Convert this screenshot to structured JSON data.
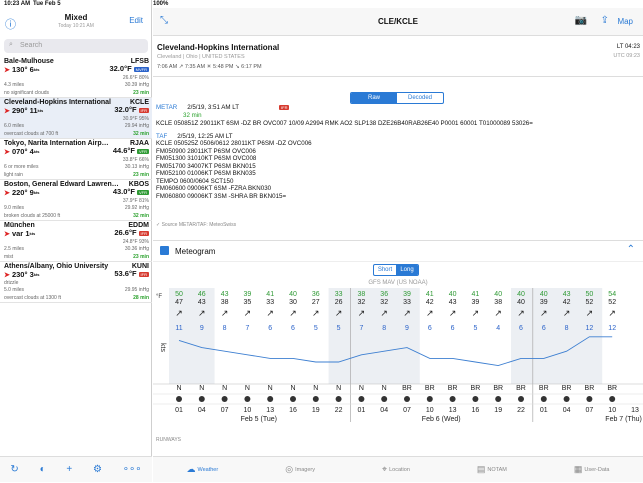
{
  "status": {
    "time": "10:23 AM",
    "date": "Tue Feb 5",
    "battery": "100%"
  },
  "left": {
    "title": "Mixed",
    "subtitle": "Today 10:21 AM",
    "edit": "Edit",
    "search_placeholder": "Search",
    "stations": [
      {
        "name": "Bale-Mulhouse",
        "code": "LFSB",
        "wind": "130° 6",
        "temp": "32.0°F",
        "flight": "MVFR",
        "ts": "26.6°F 80%",
        "vis": "4.3 miles",
        "press": "30.39 inHg",
        "wx": "no significant clouds",
        "age": "23 min"
      },
      {
        "name": "Cleveland-Hopkins International",
        "code": "KCLE",
        "wind": "290° 11",
        "temp": "32.0°F",
        "flight": "IFR",
        "ts": "30.9°F 95%",
        "vis": "6.0 miles",
        "press": "29.94 inHg",
        "wx": "overcast clouds at 700 ft",
        "age": "32 min"
      },
      {
        "name": "Tokyo, Narita Internation Airp…",
        "code": "RJAA",
        "wind": "070° 4",
        "temp": "44.6°F",
        "flight": "VFR",
        "ts": "33.8°F 66%",
        "vis": "6 or more miles",
        "press": "30.13 inHg",
        "wx": "light rain",
        "age": "23 min"
      },
      {
        "name": "Boston, General Edward Lawren…",
        "code": "KBOS",
        "wind": "220° 9",
        "temp": "43.0°F",
        "flight": "VFR",
        "ts": "37.9°F 81%",
        "vis": "9.0 miles",
        "press": "29.92 inHg",
        "wx": "broken clouds at 25000 ft",
        "age": "32 min"
      },
      {
        "name": "München",
        "code": "EDDM",
        "wind": "var 1",
        "temp": "26.6°F",
        "flight": "IFR",
        "ts": "24.8°F 93%",
        "vis": "2.5 miles",
        "press": "30.36 inHg",
        "wx": "mist",
        "age": "23 min"
      },
      {
        "name": "Athens/Albany, Ohio University",
        "code": "KUNI",
        "wind": "230° 3",
        "temp": "53.6°F",
        "flight": "IFR",
        "ts": "",
        "vis": "5.0 miles",
        "press": "29.95 inHg",
        "wx": "drizzle",
        "extra": "overcast clouds at 1300 ft",
        "age": "28 min"
      }
    ]
  },
  "right": {
    "title": "CLE/KCLE",
    "map": "Map",
    "airport": {
      "name": "Cleveland-Hopkins International",
      "location": "Cleveland | Ohio | UNITED STATES",
      "lt": "LT 04:23",
      "utc": "UTC 09:23",
      "sun": "7:06 AM ↗ 7:35 AM ☀ 5:48 PM ↘ 6:17 PM"
    },
    "toggle": {
      "raw": "Raw",
      "decoded": "Decoded"
    },
    "metar": {
      "label": "METAR",
      "time": "2/5/19, 3:51 AM LT",
      "flight": "IFR",
      "age": "32 min",
      "text": "KCLE 050851Z 29011KT 6SM -DZ BR OVC007 10/09 A2994 RMK AO2 SLP138 DZE26B40RAB26E40 P0001 60001 T01000089 53026="
    },
    "taf": {
      "label": "TAF",
      "time": "2/5/19, 12:25 AM LT",
      "lines": [
        "KCLE 050525Z 0506/0612 28011KT P6SM -DZ OVC006",
        "FM050900 28011KT P6SM OVC006",
        "FM051300 31010KT P6SM OVC008",
        "FM051700 34007KT P6SM BKN015",
        "FM052100 01006KT P6SM BKN035",
        "TEMPO 0600/0604 SCT150",
        "FM060600 09006KT 6SM -FZRA BKN030",
        "FM060800 09006KT 3SM -SHRA BR BKN015="
      ]
    },
    "source": "Source METAR/TAF: MeteoSwiss",
    "meteogram": {
      "title": "Meteogram",
      "short": "Short",
      "long": "Long",
      "model": "GFS MAV (US NOAA)"
    },
    "runways": "RUNWAYS",
    "tabs": [
      {
        "label": "Weather"
      },
      {
        "label": "Imagery"
      },
      {
        "label": "Location"
      },
      {
        "label": "NOTAM"
      },
      {
        "label": "User-Data"
      }
    ]
  },
  "chart_data": {
    "type": "table",
    "temp_hi": [
      50,
      46,
      43,
      39,
      41,
      40,
      36,
      33,
      38,
      36,
      39,
      41,
      40,
      41,
      40,
      40,
      40,
      43,
      50,
      54
    ],
    "temp_lo": [
      47,
      43,
      38,
      35,
      33,
      30,
      27,
      26,
      32,
      32,
      33,
      42,
      43,
      39,
      38,
      40,
      39,
      42,
      52,
      52
    ],
    "wind_kts": [
      11,
      9,
      8,
      7,
      6,
      6,
      5,
      5,
      7,
      8,
      9,
      6,
      6,
      5,
      4,
      6,
      6,
      8,
      12,
      12
    ],
    "wx": [
      "N",
      "N",
      "N",
      "N",
      "N",
      "N",
      "N",
      "N",
      "N",
      "N",
      "BR",
      "BR",
      "BR",
      "BR",
      "BR",
      "BR",
      "BR",
      "BR",
      "BR",
      "BR"
    ],
    "hours": [
      "01",
      "04",
      "07",
      "10",
      "13",
      "16",
      "19",
      "22",
      "01",
      "04",
      "07",
      "10",
      "13",
      "16",
      "19",
      "22",
      "01",
      "04",
      "07",
      "10",
      "13",
      "16",
      "19"
    ],
    "days": [
      "Feb 5 (Tue)",
      "Feb 6 (Wed)",
      "Feb 7 (Thu)"
    ],
    "ylabel": "kts"
  }
}
